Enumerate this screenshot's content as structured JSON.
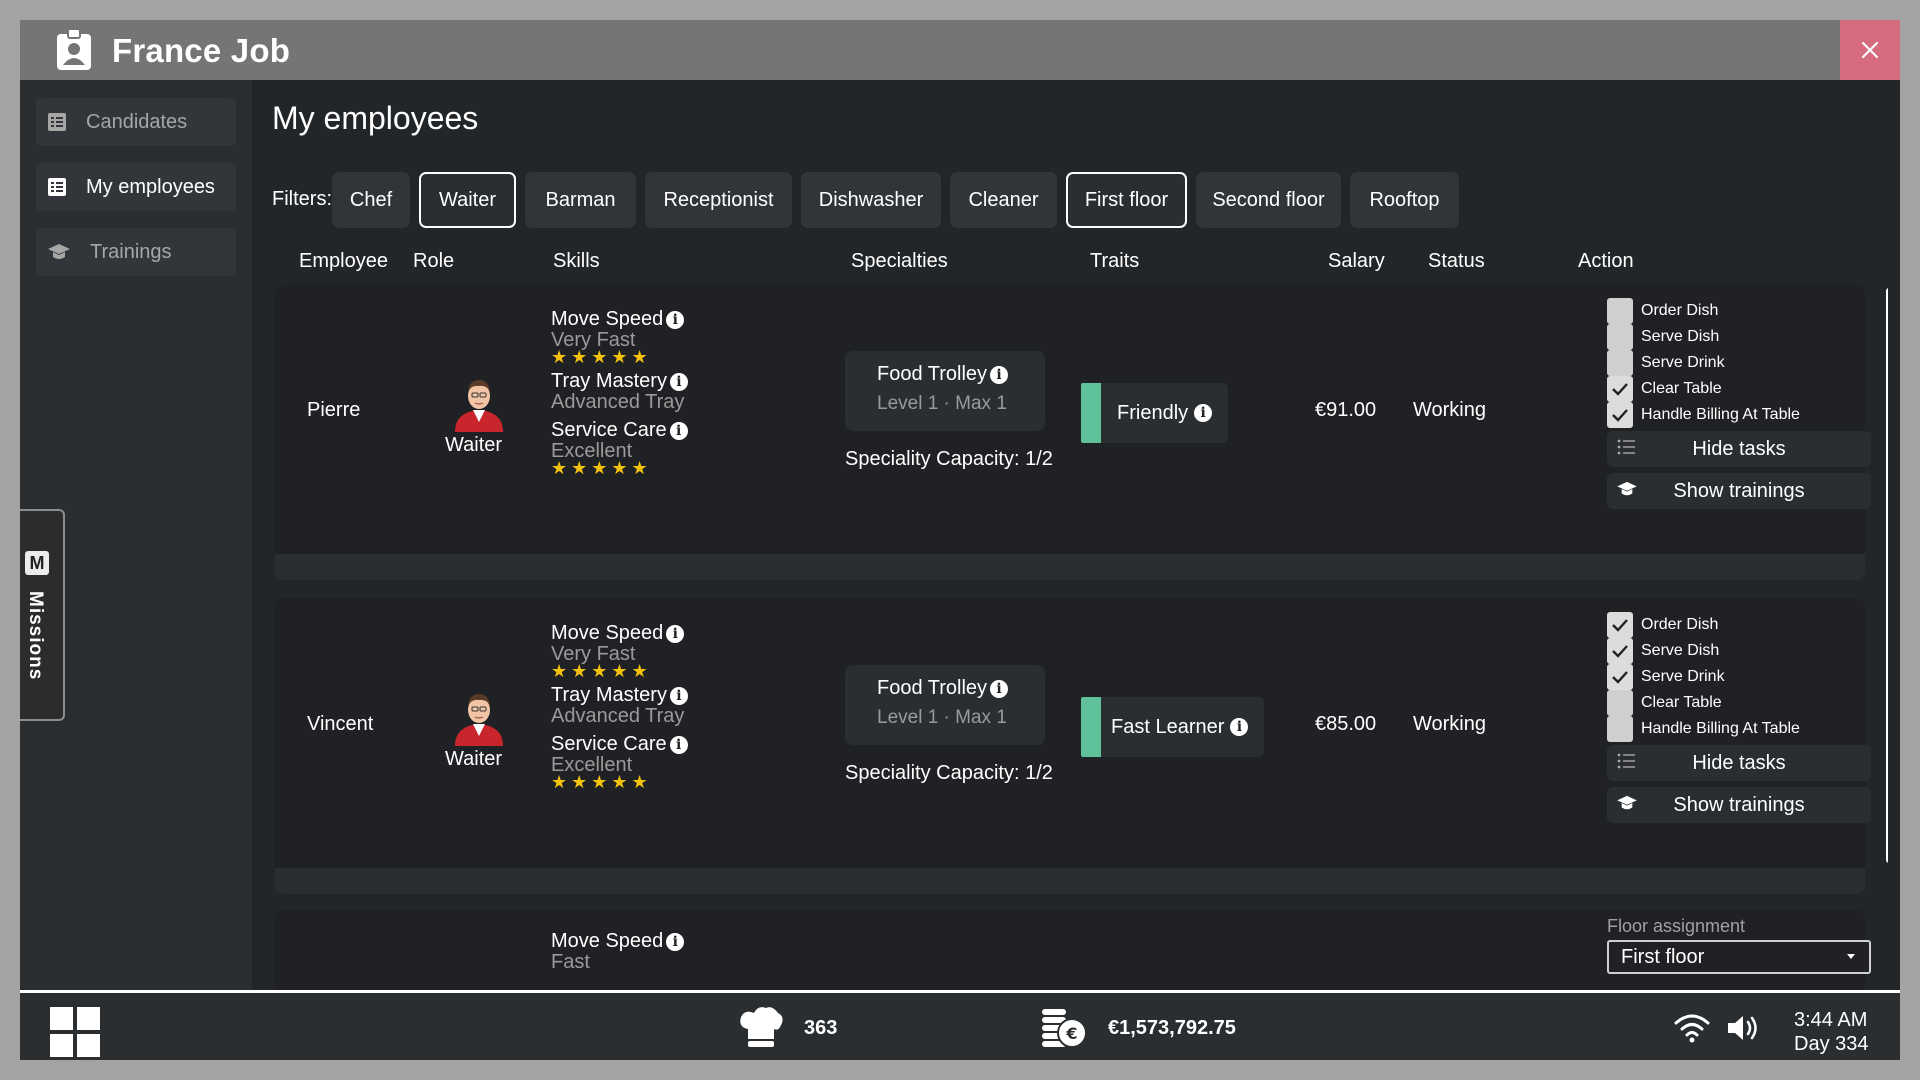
{
  "app": {
    "title": "France Job"
  },
  "sidebar": {
    "items": [
      {
        "label": "Candidates",
        "icon": "list-icon"
      },
      {
        "label": "My employees",
        "icon": "list-icon",
        "active": true
      },
      {
        "label": "Trainings",
        "icon": "graduation-cap-icon"
      }
    ]
  },
  "missions": {
    "badge": "M",
    "label": "Missions"
  },
  "main": {
    "title": "My employees",
    "filters_label": "Filters:",
    "filters": [
      {
        "label": "Chef",
        "active": false
      },
      {
        "label": "Waiter",
        "active": true
      },
      {
        "label": "Barman",
        "active": false
      },
      {
        "label": "Receptionist",
        "active": false
      },
      {
        "label": "Dishwasher",
        "active": false
      },
      {
        "label": "Cleaner",
        "active": false
      },
      {
        "label": "First floor",
        "active": true
      },
      {
        "label": "Second floor",
        "active": false
      },
      {
        "label": "Rooftop",
        "active": false
      }
    ],
    "columns": [
      "Employee",
      "Role",
      "Skills",
      "Specialties",
      "Traits",
      "Salary",
      "Status",
      "Action"
    ]
  },
  "employees": [
    {
      "name": "Pierre",
      "role": "Waiter",
      "skills": [
        {
          "name": "Move Speed",
          "level": "Very Fast",
          "stars": 5
        },
        {
          "name": "Tray Mastery",
          "level": "Advanced Tray"
        },
        {
          "name": "Service Care",
          "level": "Excellent",
          "stars": 5
        }
      ],
      "specialty": {
        "name": "Food Trolley",
        "level": "Level 1 · Max 1",
        "capacity": "Speciality Capacity: 1/2"
      },
      "trait": "Friendly",
      "salary": "€91.00",
      "status": "Working",
      "tasks": [
        {
          "label": "Order Dish",
          "checked": false
        },
        {
          "label": "Serve Dish",
          "checked": false
        },
        {
          "label": "Serve Drink",
          "checked": false
        },
        {
          "label": "Clear Table",
          "checked": true
        },
        {
          "label": "Handle Billing At Table",
          "checked": true
        }
      ],
      "hide_tasks": "Hide tasks",
      "show_trainings": "Show trainings"
    },
    {
      "name": "Vincent",
      "role": "Waiter",
      "skills": [
        {
          "name": "Move Speed",
          "level": "Very Fast",
          "stars": 5
        },
        {
          "name": "Tray Mastery",
          "level": "Advanced Tray"
        },
        {
          "name": "Service Care",
          "level": "Excellent",
          "stars": 5
        }
      ],
      "specialty": {
        "name": "Food Trolley",
        "level": "Level 1 · Max 1",
        "capacity": "Speciality Capacity: 1/2"
      },
      "trait": "Fast Learner",
      "salary": "€85.00",
      "status": "Working",
      "tasks": [
        {
          "label": "Order Dish",
          "checked": true
        },
        {
          "label": "Serve Dish",
          "checked": true
        },
        {
          "label": "Serve Drink",
          "checked": true
        },
        {
          "label": "Clear Table",
          "checked": false
        },
        {
          "label": "Handle Billing At Table",
          "checked": false
        }
      ],
      "hide_tasks": "Hide tasks",
      "show_trainings": "Show trainings"
    },
    {
      "skills": [
        {
          "name": "Move Speed",
          "level": "Fast"
        }
      ],
      "floor_assignment_label": "Floor assignment",
      "floor_assignment_value": "First floor"
    }
  ],
  "taskbar": {
    "chef_count": "363",
    "money": "€1,573,792.75",
    "time": "3:44 AM",
    "day": "Day 334"
  },
  "colors": {
    "accent_close": "#d56b7c",
    "trait_bar": "#5fc19a",
    "star": "#f4c20d"
  }
}
